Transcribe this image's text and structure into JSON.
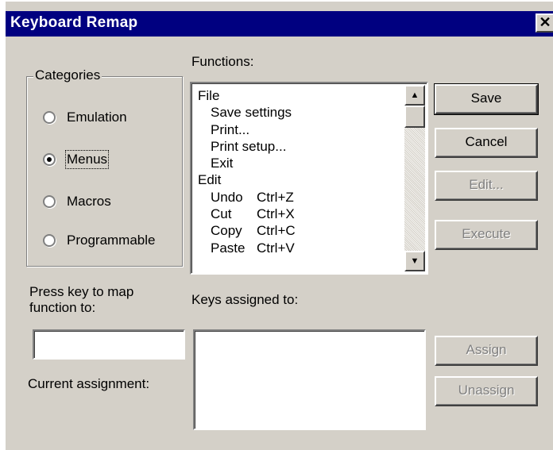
{
  "window": {
    "title": "Keyboard  Remap",
    "close_glyph": "✕"
  },
  "categories": {
    "legend": "Categories",
    "options": [
      {
        "label": "Emulation",
        "checked": false
      },
      {
        "label": "Menus",
        "checked": true
      },
      {
        "label": "Macros",
        "checked": false
      },
      {
        "label": "Programmable",
        "checked": false
      }
    ]
  },
  "functions": {
    "label": "Functions:",
    "items": [
      {
        "name": "File",
        "shortcut": ""
      },
      {
        "name": "Save settings",
        "shortcut": ""
      },
      {
        "name": "Print...",
        "shortcut": ""
      },
      {
        "name": "Print setup...",
        "shortcut": ""
      },
      {
        "name": "Exit",
        "shortcut": ""
      },
      {
        "name": "Edit",
        "shortcut": ""
      },
      {
        "name": "Undo",
        "shortcut": "Ctrl+Z"
      },
      {
        "name": "Cut",
        "shortcut": "Ctrl+X"
      },
      {
        "name": "Copy",
        "shortcut": "Ctrl+C"
      },
      {
        "name": "Paste",
        "shortcut": "Ctrl+V"
      }
    ]
  },
  "buttons": {
    "save": "Save",
    "cancel": "Cancel",
    "edit": "Edit...",
    "execute": "Execute",
    "assign": "Assign",
    "unassign": "Unassign"
  },
  "press_key_label": "Press key to map function to:",
  "key_input_value": "",
  "current_assignment_label": "Current assignment:",
  "keys_assigned_label": "Keys assigned to:",
  "scroll_up_glyph": "▲",
  "scroll_down_glyph": "▼"
}
